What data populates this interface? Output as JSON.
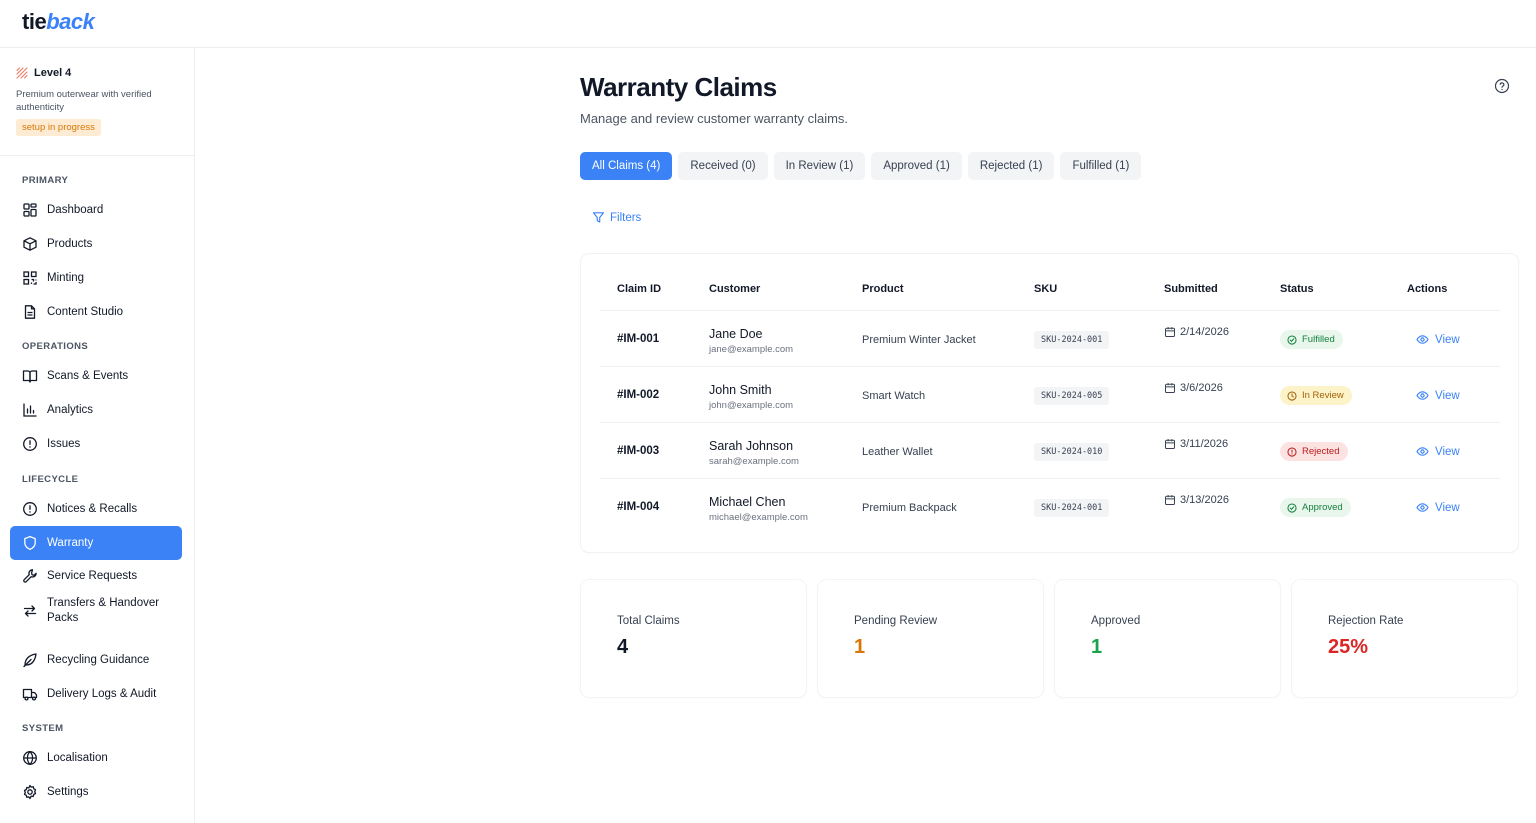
{
  "brand": {
    "logo_part1": "tie",
    "logo_part2": "back"
  },
  "level": {
    "title": "Level 4",
    "description": "Premium outerwear with verified authenticity",
    "badge": "setup in progress"
  },
  "sidebar": {
    "sections": [
      {
        "title": "PRIMARY"
      },
      {
        "title": "OPERATIONS"
      },
      {
        "title": "LIFECYCLE"
      },
      {
        "title": "SYSTEM"
      }
    ],
    "items": [
      {
        "label": "Dashboard",
        "icon": "dashboard-icon"
      },
      {
        "label": "Products",
        "icon": "box-icon"
      },
      {
        "label": "Minting",
        "icon": "qr-code-icon"
      },
      {
        "label": "Content Studio",
        "icon": "document-icon"
      },
      {
        "label": "Scans & Events",
        "icon": "book-open-icon"
      },
      {
        "label": "Analytics",
        "icon": "bar-chart-icon"
      },
      {
        "label": "Issues",
        "icon": "alert-circle-icon"
      },
      {
        "label": "Notices & Recalls",
        "icon": "alert-circle-icon"
      },
      {
        "label": "Warranty",
        "icon": "shield-icon",
        "active": true
      },
      {
        "label": "Service Requests",
        "icon": "wrench-icon"
      },
      {
        "label": "Transfers & Handover Packs",
        "icon": "arrows-swap-icon"
      },
      {
        "label": "Recycling Guidance",
        "icon": "leaf-icon"
      },
      {
        "label": "Delivery Logs & Audit",
        "icon": "truck-icon"
      },
      {
        "label": "Localisation",
        "icon": "globe-icon"
      },
      {
        "label": "Settings",
        "icon": "gear-icon"
      }
    ]
  },
  "page": {
    "title": "Warranty Claims",
    "subtitle": "Manage and review customer warranty claims."
  },
  "tabs": [
    {
      "label": "All Claims (4)",
      "active": true
    },
    {
      "label": "Received (0)"
    },
    {
      "label": "In Review (1)"
    },
    {
      "label": "Approved (1)"
    },
    {
      "label": "Rejected (1)"
    },
    {
      "label": "Fulfilled (1)"
    }
  ],
  "filters_label": "Filters",
  "table": {
    "headers": [
      "Claim ID",
      "Customer",
      "Product",
      "SKU",
      "Submitted",
      "Status",
      "Actions"
    ],
    "rows": [
      {
        "id": "#IM-001",
        "name": "Jane Doe",
        "email": "jane@example.com",
        "product": "Premium Winter Jacket",
        "sku": "SKU-2024-001",
        "submitted": "2/14/2026",
        "status": "Fulfilled",
        "status_kind": "fulfilled",
        "action": "View"
      },
      {
        "id": "#IM-002",
        "name": "John Smith",
        "email": "john@example.com",
        "product": "Smart Watch",
        "sku": "SKU-2024-005",
        "submitted": "3/6/2026",
        "status": "In Review",
        "status_kind": "review",
        "action": "View"
      },
      {
        "id": "#IM-003",
        "name": "Sarah Johnson",
        "email": "sarah@example.com",
        "product": "Leather Wallet",
        "sku": "SKU-2024-010",
        "submitted": "3/11/2026",
        "status": "Rejected",
        "status_kind": "rejected",
        "action": "View"
      },
      {
        "id": "#IM-004",
        "name": "Michael Chen",
        "email": "michael@example.com",
        "product": "Premium Backpack",
        "sku": "SKU-2024-001",
        "submitted": "3/13/2026",
        "status": "Approved",
        "status_kind": "approved",
        "action": "View"
      }
    ]
  },
  "stats": [
    {
      "label": "Total Claims",
      "value": "4",
      "color": "#111827"
    },
    {
      "label": "Pending Review",
      "value": "1",
      "color": "#d97706"
    },
    {
      "label": "Approved",
      "value": "1",
      "color": "#16a34a"
    },
    {
      "label": "Rejection Rate",
      "value": "25%",
      "color": "#dc2626"
    }
  ],
  "colors": {
    "accent": "#3b82f6",
    "badge_bg": "#fdecd3",
    "badge_text": "#d97706"
  }
}
